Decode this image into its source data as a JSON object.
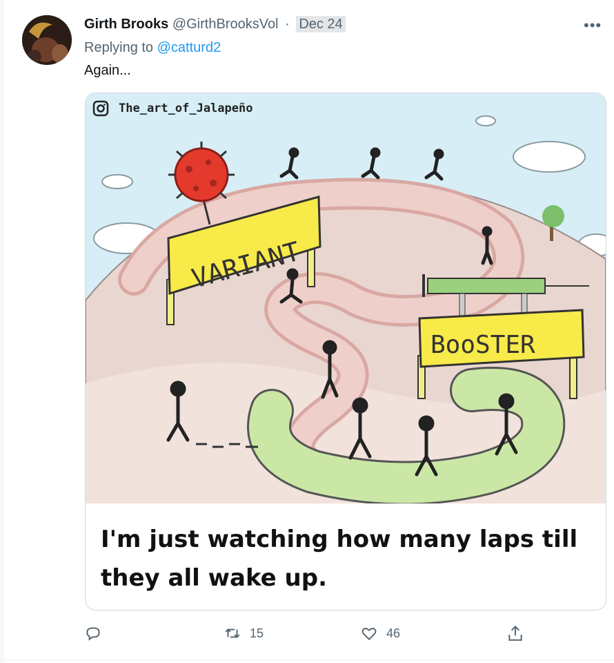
{
  "tweet": {
    "author_name": "Girth Brooks",
    "author_handle": "@GirthBrooksVol",
    "separator": "·",
    "date": "Dec 24",
    "reply_prefix": "Replying to",
    "reply_to": "@catturd2",
    "text": "Again..."
  },
  "image": {
    "watermark": "The_art_of_Jalapeño",
    "sign_variant": "VARIANT",
    "sign_booster": "BooSTER",
    "caption": "I'm just watching how many laps till they all wake up."
  },
  "actions": {
    "reply_count": "",
    "retweet_count": "15",
    "like_count": "46"
  },
  "colors": {
    "accent": "#1d9bf0",
    "muted": "#536471",
    "sky": "#cdeaf4",
    "track": "#e9c7c2",
    "green_path": "#cbe7a6",
    "sign": "#f7ea49",
    "virus": "#e33a2d"
  }
}
